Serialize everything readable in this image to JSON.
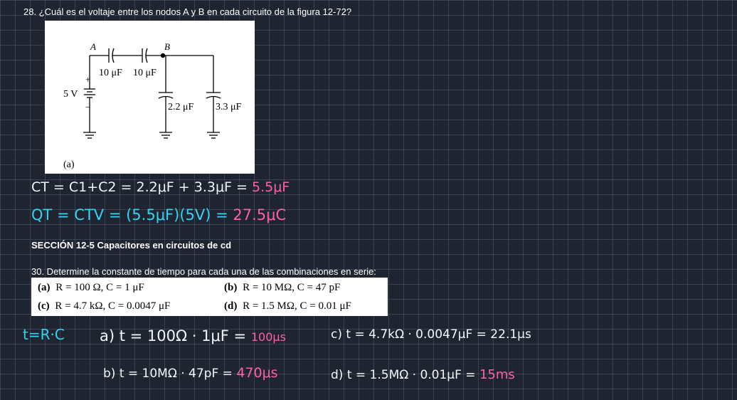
{
  "problem28": {
    "question": "28. ¿Cuál es el voltaje entre los nodos A y B en cada circuito de la figura 12-72?",
    "figure": {
      "node_a": "A",
      "node_b": "B",
      "plus": "+",
      "minus": "−",
      "source": "5 V",
      "c1": "10 μF",
      "c2": "10 μF",
      "c3": "2.2 μF",
      "c4": "3.3 μF",
      "part": "(a)"
    },
    "notes": {
      "ct_expr": "CT = C1+C2 = 2.2μF + 3.3μF =",
      "ct_result": "5.5μF",
      "qt_expr": "QT = CTV = (5.5μF)(5V) =",
      "qt_result": "27.5μC"
    }
  },
  "section_heading": "SECCIÓN 12-5 Capacitores en circuitos de cd",
  "problem30": {
    "question": "30. Determine la constante de tiempo para cada una de las combinaciones en serie:",
    "options": [
      {
        "label": "(a)",
        "expr": "R = 100 Ω, C = 1 μF"
      },
      {
        "label": "(b)",
        "expr": "R = 10 MΩ, C = 47 pF"
      },
      {
        "label": "(c)",
        "expr": "R = 4.7 kΩ, C = 0.0047 μF"
      },
      {
        "label": "(d)",
        "expr": "R = 1.5 MΩ, C = 0.01 μF"
      }
    ],
    "notes": {
      "formula": "t=R·C",
      "a_expr": "a) t = 100Ω · 1μF =",
      "a_result": "100μs",
      "b_expr": "b) t = 10MΩ · 47pF =",
      "b_result": "470μs",
      "c_expr": "c) t = 4.7kΩ · 0.0047μF = 22.1μs",
      "d_expr": "d) t = 1.5MΩ · 0.01μF =",
      "d_result": "15ms"
    }
  },
  "colors": {
    "background": "#1e2430",
    "grid": "#788caa",
    "ink_white": "#f4f6fb",
    "ink_pink": "#ff5fa8",
    "ink_cyan": "#35d2f2"
  }
}
